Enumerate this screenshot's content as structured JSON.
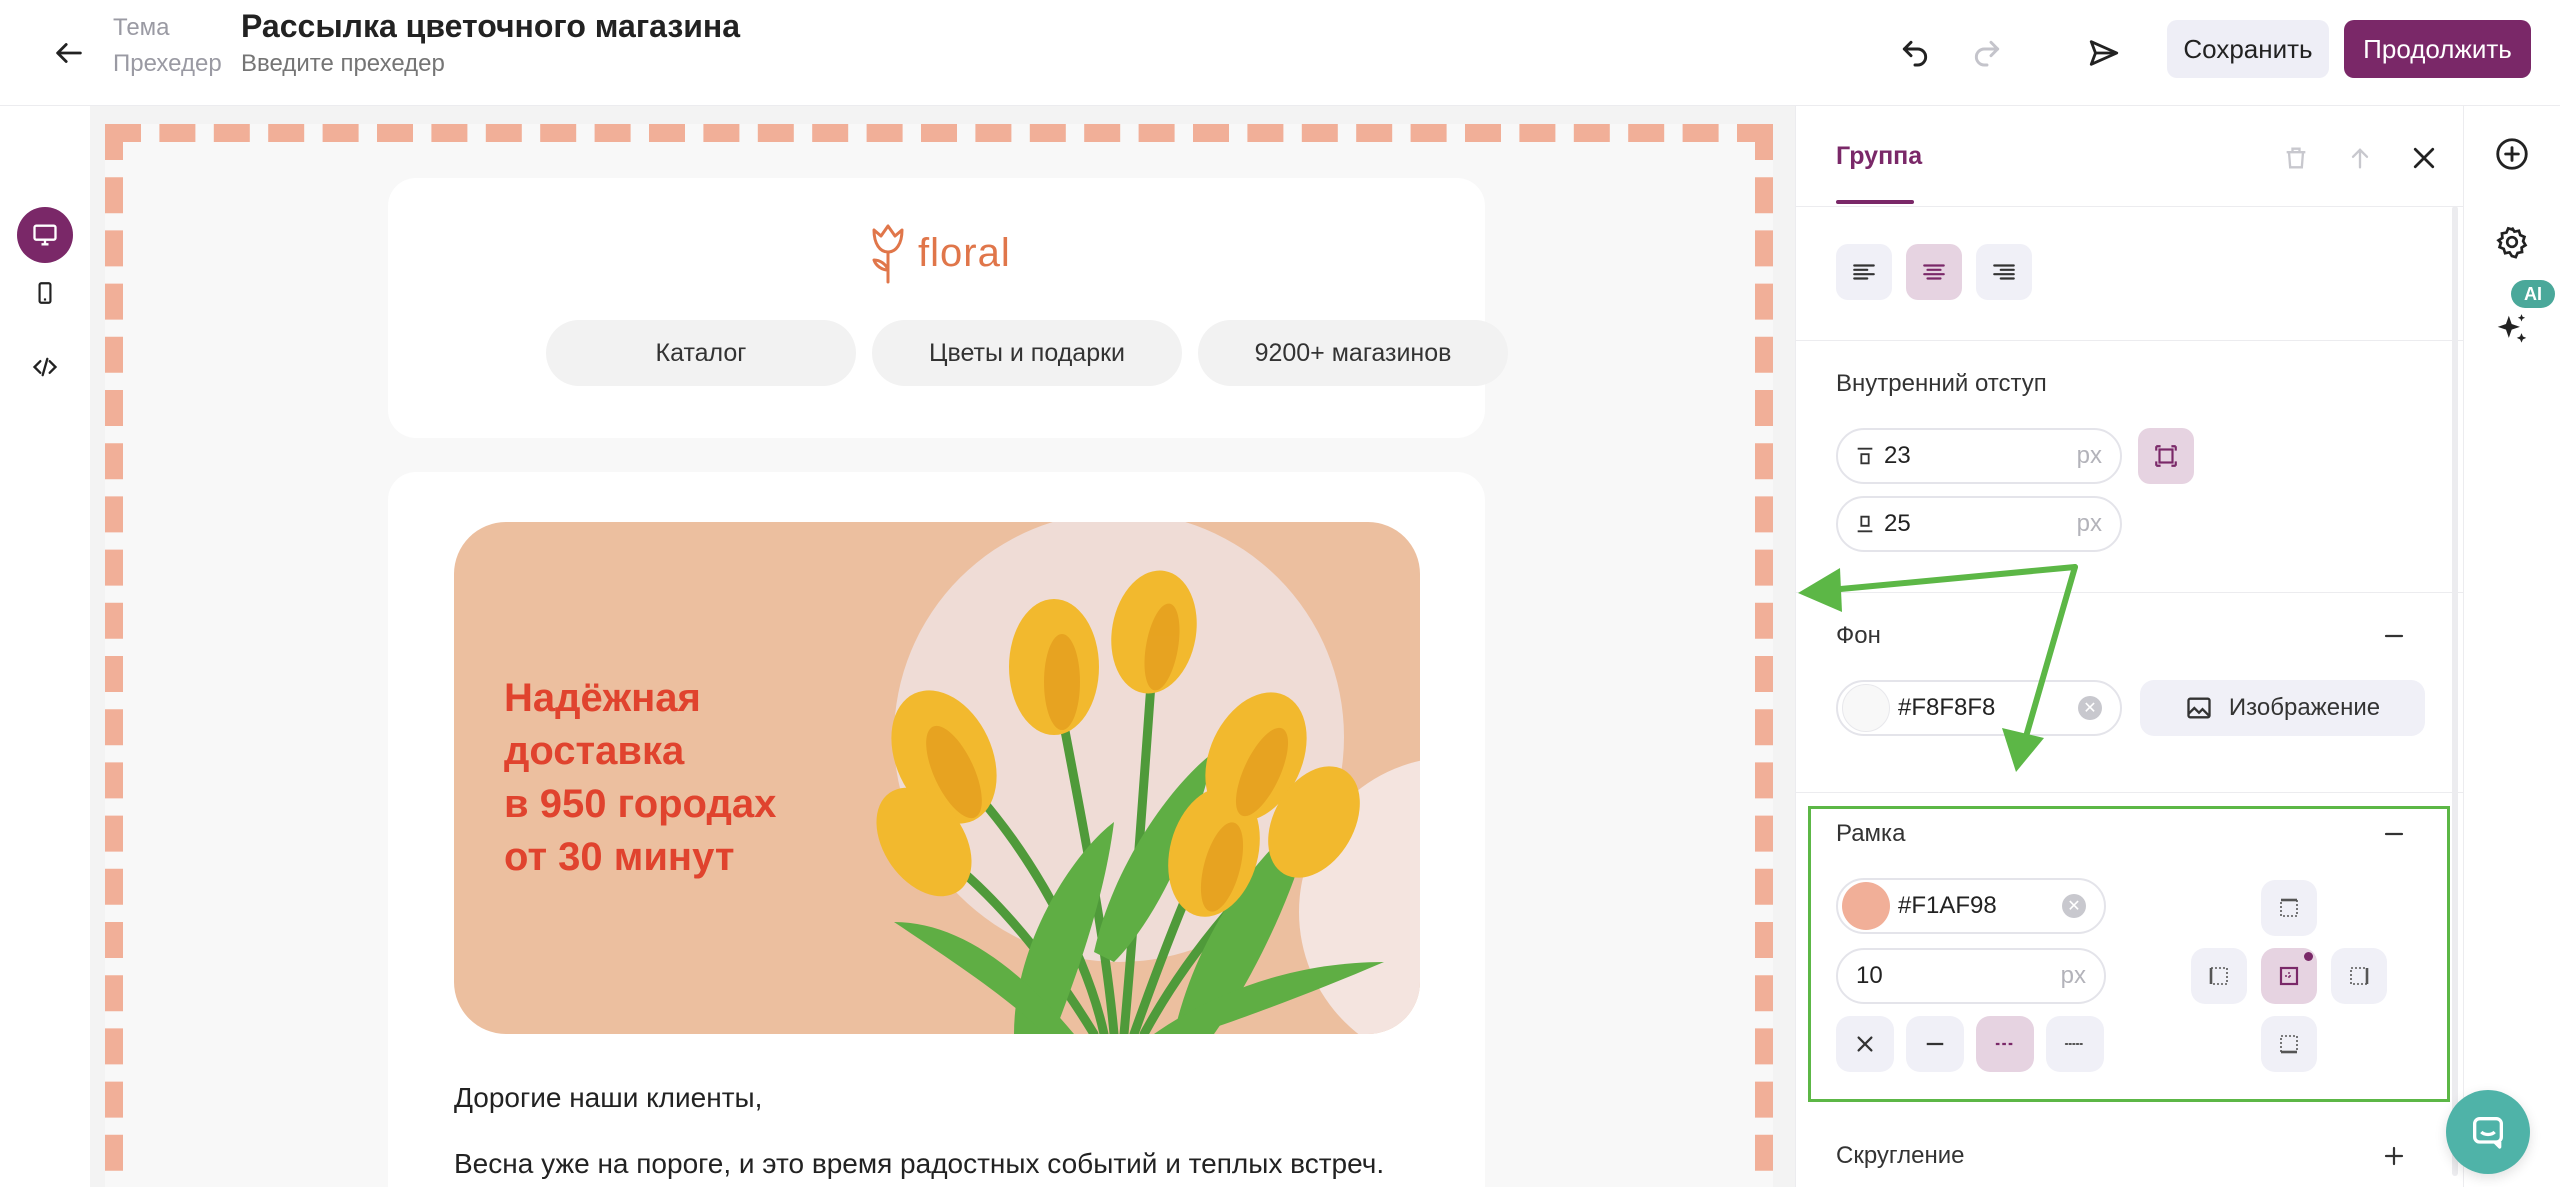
{
  "header": {
    "theme_label": "Тема",
    "subject": "Рассылка цветочного магазина",
    "preheader_label": "Прехедер",
    "preheader_placeholder": "Введите прехедер",
    "save_label": "Сохранить",
    "continue_label": "Продолжить"
  },
  "email": {
    "logo_text": "floral",
    "nav": [
      "Каталог",
      "Цветы и подарки",
      "9200+ магазинов"
    ],
    "banner_lines": [
      "Надёжная",
      "доставка",
      "в 950 городах",
      "от 30 минут"
    ],
    "greeting": "Дорогие наши клиенты,",
    "paragraph": "Весна уже на пороге, и это время радостных событий и теплых встреч."
  },
  "panel": {
    "tab_label": "Группа",
    "padding": {
      "title": "Внутренний отступ",
      "top": "23",
      "bottom": "25",
      "unit": "px"
    },
    "background": {
      "title": "Фон",
      "color": "#F8F8F8",
      "image_label": "Изображение"
    },
    "border": {
      "title": "Рамка",
      "color": "#F1AF98",
      "width": "10",
      "unit": "px"
    },
    "radius": {
      "title": "Скругление"
    }
  },
  "rail": {
    "ai_badge": "AI"
  },
  "colors": {
    "accent": "#7a2868",
    "border_color": "#f1af98",
    "highlight": "#5cb746",
    "banner_bg": "#ecbf9f",
    "banner_text": "#e0432e"
  }
}
